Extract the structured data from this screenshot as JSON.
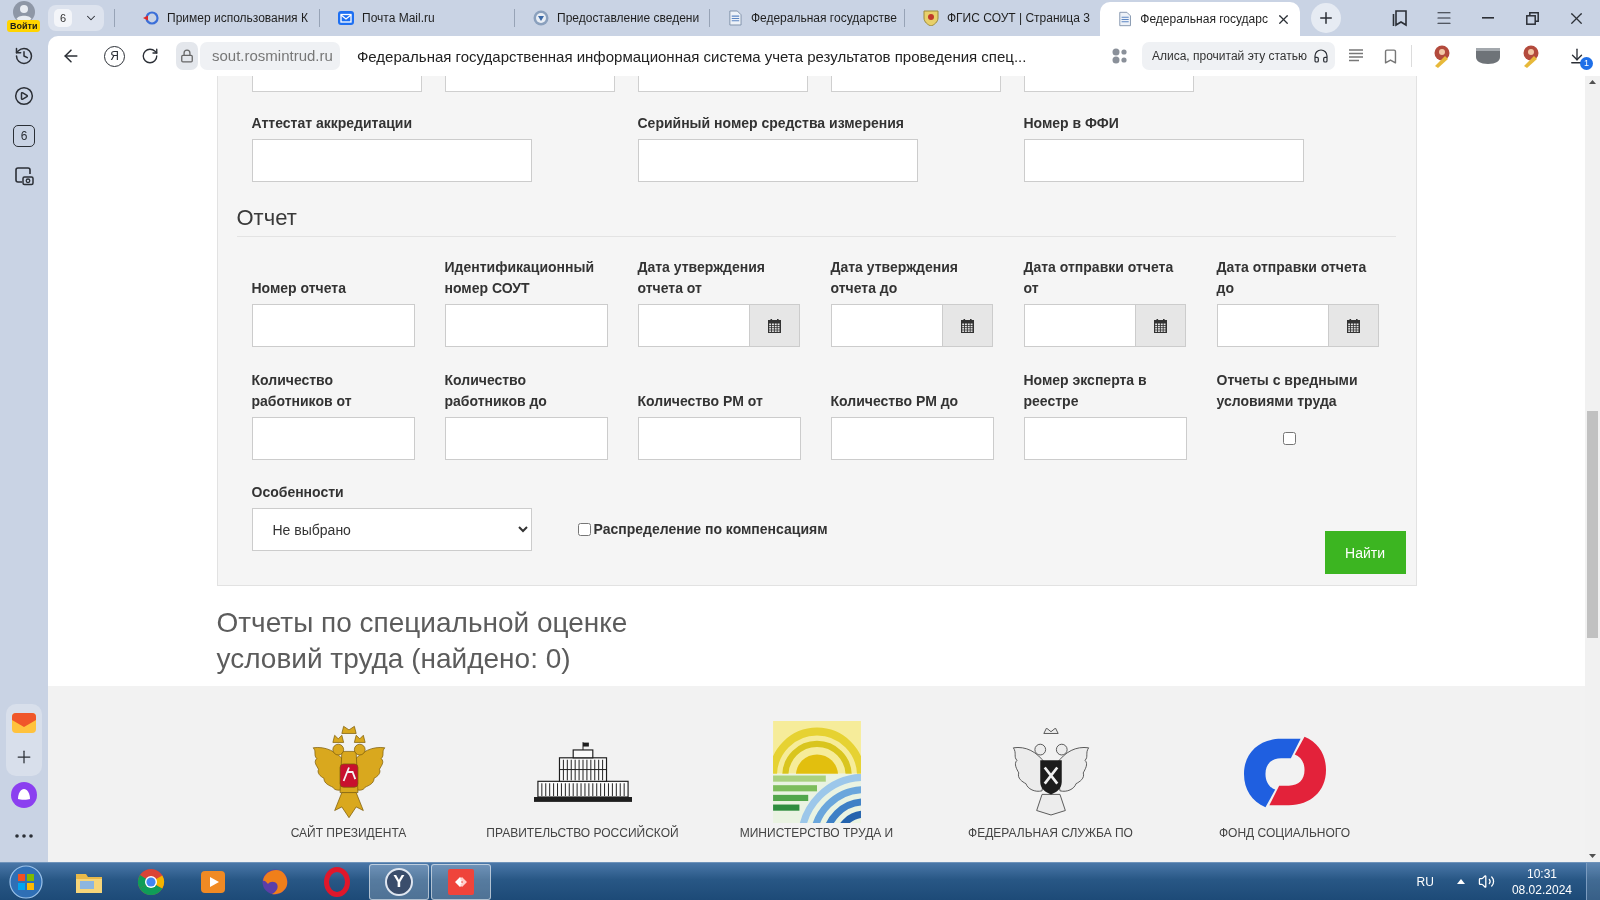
{
  "browser": {
    "profile": {
      "label": "Войти"
    },
    "tab_counter": "6",
    "tabs": [
      {
        "title": "Пример использования К",
        "kind": "sync",
        "selected": false
      },
      {
        "title": "Почта Mail.ru",
        "kind": "mail",
        "selected": false
      },
      {
        "title": "Предоставление сведени",
        "kind": "emblem",
        "selected": false
      },
      {
        "title": "Федеральная государстве",
        "kind": "document",
        "selected": false
      },
      {
        "title": "ФГИС СОУТ | Страница 3",
        "kind": "crest",
        "selected": false
      },
      {
        "title": "Федеральная государс",
        "kind": "document",
        "selected": true
      }
    ],
    "home_button": "Я",
    "address": {
      "domain": "sout.rosmintrud.ru",
      "page_title": "Федеральная государственная информационная система учета результатов проведения спец..."
    },
    "reader_button": "Алиса, прочитай эту статью",
    "downloads_badge": "1",
    "sidebar": {
      "tab_counter": "6"
    }
  },
  "form": {
    "cut_fields": [
      {
        "kind": "text"
      },
      {
        "kind": "text"
      },
      {
        "kind": "text"
      },
      {
        "kind": "text"
      },
      {
        "kind": "text"
      }
    ],
    "accreditation_fields": [
      {
        "label": "Аттестат аккредитации"
      },
      {
        "label": "Серийный номер средства измерения"
      },
      {
        "label": "Номер в ФФИ"
      }
    ],
    "report": {
      "title": "Отчет",
      "fields": [
        {
          "label": "Номер отчета",
          "kind": "text"
        },
        {
          "label": "Идентификационный номер СОУТ",
          "kind": "text"
        },
        {
          "label": "Дата утверждения отчета от",
          "kind": "date"
        },
        {
          "label": "Дата утверждения отчета до",
          "kind": "date"
        },
        {
          "label": "Дата отправки отчета от",
          "kind": "date"
        },
        {
          "label": "Дата отправки отчета до",
          "kind": "date"
        },
        {
          "label": "Количество работников от",
          "kind": "text"
        },
        {
          "label": "Количество работников до",
          "kind": "text"
        },
        {
          "label": "Количество РМ от",
          "kind": "text"
        },
        {
          "label": "Количество РМ до",
          "kind": "text"
        },
        {
          "label": "Номер эксперта в реестре",
          "kind": "text"
        },
        {
          "label": "Отчеты с вредными условиями труда",
          "kind": "checkbox",
          "checked": false
        }
      ]
    },
    "features": {
      "label": "Особенности",
      "value": "Не выбрано"
    },
    "compensation": {
      "label": "Распределение по компенсациям",
      "checked": false
    },
    "submit": "Найти"
  },
  "results": {
    "title": "Отчеты по специальной оценке условий труда (найдено: 0)"
  },
  "footer": {
    "links": [
      {
        "kind": "president",
        "caption": "САЙТ ПРЕЗИДЕНТА"
      },
      {
        "kind": "government",
        "caption": "ПРАВИТЕЛЬСТВО РОССИЙСКОЙ"
      },
      {
        "kind": "ministry",
        "caption": "МИНИСТЕРСТВО ТРУДА И"
      },
      {
        "kind": "service",
        "caption": "ФЕДЕРАЛЬНАЯ СЛУЖБА ПО"
      },
      {
        "kind": "fund",
        "caption": "ФОНД СОЦИАЛЬНОГО"
      }
    ]
  },
  "taskbar": {
    "apps": [
      {
        "kind": "explorer",
        "selected": false
      },
      {
        "kind": "chrome",
        "selected": false
      },
      {
        "kind": "media",
        "selected": false
      },
      {
        "kind": "firefox",
        "selected": false
      },
      {
        "kind": "opera",
        "selected": false
      },
      {
        "kind": "yandex",
        "glyph": "Y",
        "selected": true
      },
      {
        "kind": "remote",
        "selected": true
      }
    ],
    "language": "RU",
    "time": "10:31",
    "date": "08.02.2024"
  }
}
